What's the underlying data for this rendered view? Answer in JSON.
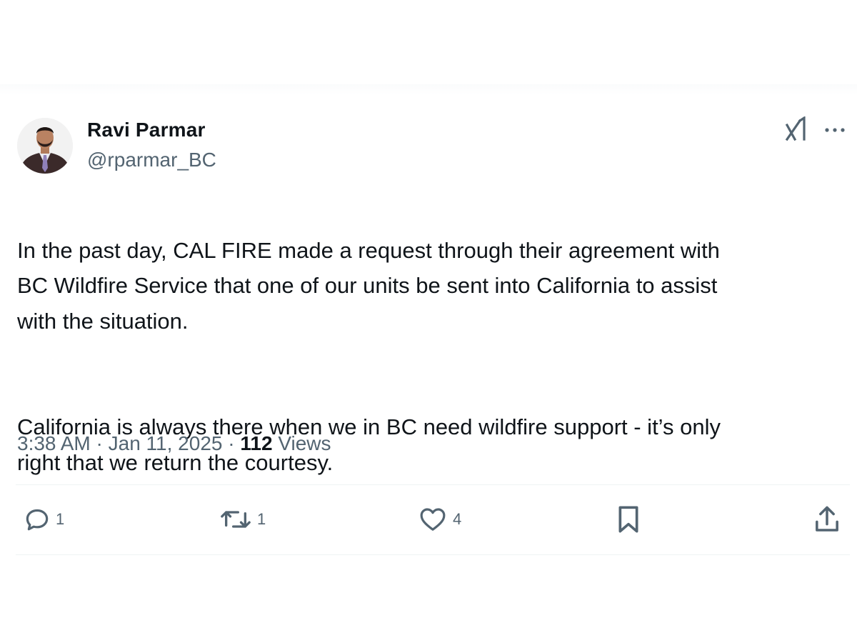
{
  "author": {
    "display_name": "Ravi Parmar",
    "handle": "@rparmar_BC"
  },
  "header_icons": [
    "grok-icon",
    "more-icon"
  ],
  "tweet": {
    "paragraphs": [
      "In the past day, CAL FIRE made a request through their agreement with\nBC Wildfire Service that one of our units be sent into California to assist\nwith the situation.",
      "California is always there when we in BC need wildfire support - it’s only\nright that we return the courtesy."
    ]
  },
  "meta": {
    "time": "3:38 AM",
    "separator": "·",
    "date": "Jan 11, 2025",
    "views_count": "112",
    "views_label": "Views"
  },
  "actions": {
    "reply": {
      "icon": "reply-icon",
      "count": "1"
    },
    "repost": {
      "icon": "repost-icon",
      "count": "1"
    },
    "like": {
      "icon": "heart-icon",
      "count": "4"
    },
    "bookmark": {
      "icon": "bookmark-icon"
    },
    "share": {
      "icon": "share-icon"
    }
  },
  "colors": {
    "text_primary": "#0f1419",
    "text_secondary": "#536471",
    "divider": "#eff3f4"
  }
}
